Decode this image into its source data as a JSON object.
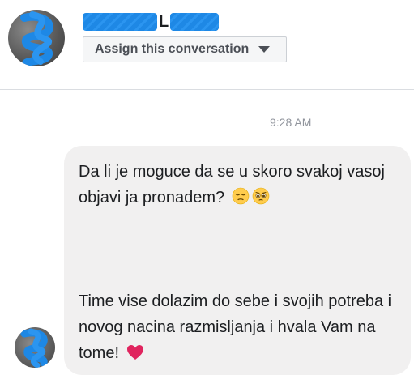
{
  "contact": {
    "name_visible_initial": "L"
  },
  "header": {
    "assign_label": "Assign this conversation"
  },
  "conversation": {
    "timestamp": "9:28 AM",
    "message": {
      "line_block_1": "Da li je moguce da se u skoro svakoj vasoj objavi ja pronadem?",
      "line_block_2": "Time vise dolazim do sebe i svojih potreba i novog nacina razmisljanja i hvala Vam na tome!",
      "emojis_block_1": [
        "relieved-face-emoji",
        "pleading-face-emoji"
      ],
      "emojis_block_2": [
        "red-heart-emoji"
      ]
    }
  },
  "colors": {
    "bubble_bg": "#f1f0f0",
    "redaction": "#1e88e5",
    "heart": "#e0245e"
  }
}
